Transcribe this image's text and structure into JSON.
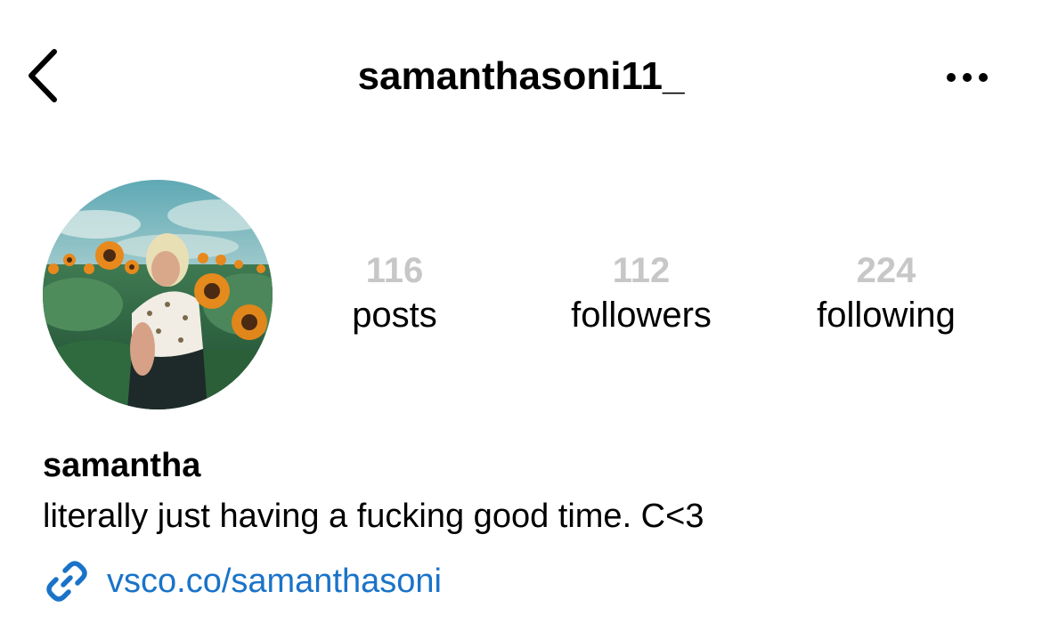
{
  "header": {
    "username": "samanthasoni11_",
    "back_icon": "chevron-left-icon",
    "more_icon": "more-horizontal-icon"
  },
  "profile": {
    "avatar": "profile-photo-sunflower-field",
    "stats": [
      {
        "count": "116",
        "label": "posts"
      },
      {
        "count": "112",
        "label": "followers"
      },
      {
        "count": "224",
        "label": "following"
      }
    ],
    "display_name": "samantha",
    "bio": "literally just having a fucking good time. C<3",
    "link": {
      "icon": "link-icon",
      "text": "vsco.co/samanthasoni",
      "color": "#1a73c8"
    }
  },
  "colors": {
    "stat_count": "#c7c7c7",
    "text": "#000000",
    "background": "#ffffff"
  }
}
